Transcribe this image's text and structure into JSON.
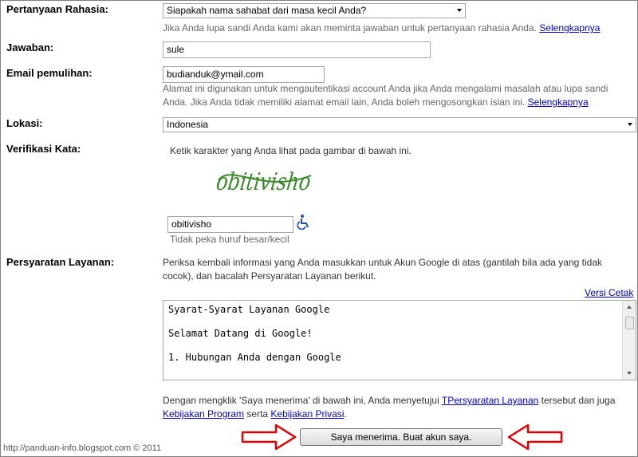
{
  "security_question": {
    "label": "Pertanyaan Rahasia:",
    "selected": "Siapakah nama sahabat dari masa kecil Anda?",
    "hint": "Jika Anda lupa sandi Anda kami akan meminta jawaban untuk pertanyaan rahasia Anda.",
    "link": "Selengkapnya"
  },
  "answer": {
    "label": "Jawaban:",
    "value": "sule"
  },
  "recovery_email": {
    "label": "Email pemulihan:",
    "value": "budianduk@ymail.com",
    "hint_line1": "Alamat ini digunakan untuk mengautentikasi account Anda jika Anda mengalami masalah atau lupa sandi",
    "hint_line2": "Anda. Jika Anda tidak memiliki alamat email lain, Anda boleh mengosongkan isian ini.",
    "link": "Selengkapnya"
  },
  "location": {
    "label": "Lokasi:",
    "selected": "Indonesia"
  },
  "word_verification": {
    "label": "Verifikasi Kata:",
    "instruction": "Ketik karakter yang Anda lihat pada gambar di bawah ini.",
    "captcha_text": "obitivisho",
    "value": "obitivisho",
    "hint": "Tidak peka huruf besar/kecil"
  },
  "terms": {
    "label": "Persyaratan Layanan:",
    "intro_line1": "Periksa kembali informasi yang Anda masukkan untuk Akun Google di atas (gantilah bila ada yang tidak",
    "intro_line2": "cocok), dan bacalah Persyaratan Layanan berikut.",
    "print_link": "Versi Cetak",
    "box_lines": [
      "Syarat-Syarat Layanan Google",
      "Selamat Datang di Google!",
      "1. Hubungan Anda dengan Google"
    ],
    "agree_part1": "Dengan mengklik 'Saya menerima' di bawah ini, Anda menyetujui ",
    "agree_link_terms": "TPersyaratan Layanan",
    "agree_part2": " tersebut dan juga",
    "agree_link_program": "Kebijakan Program",
    "agree_part3": " serta ",
    "agree_link_privacy": "Kebijakan Privasi",
    "agree_part4": "."
  },
  "submit_button": "Saya menerima. Buat akun saya.",
  "footer": "http://panduan-info.blogspot.com © 2011",
  "colors": {
    "link": "#0000cc",
    "arrow": "#e00000",
    "captcha": "#3a8a2a"
  },
  "icons": {
    "accessibility": "wheelchair-icon",
    "dropdown": "chevron-down-icon"
  }
}
